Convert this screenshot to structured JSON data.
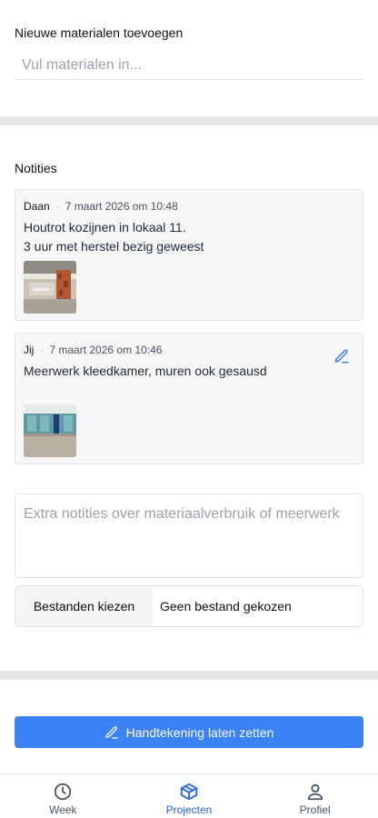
{
  "materials": {
    "title": "Nieuwe materialen toevoegen",
    "placeholder": "Vul materialen in..."
  },
  "notes": {
    "title": "Notities",
    "items": [
      {
        "author": "Daan",
        "separator": "·",
        "timestamp": "7 maart 2026 om 10:48",
        "text": "Houtrot kozijnen in lokaal 11.\n3 uur met herstel bezig geweest",
        "editable": false
      },
      {
        "author": "Jij",
        "separator": "·",
        "timestamp": "7 maart 2026 om 10:46",
        "text": "Meerwerk kleedkamer, muren ook gesausd",
        "editable": true
      }
    ],
    "extra_placeholder": "Extra notities over materiaalverbruik of meerwerk",
    "file_button": "Bestanden kiezen",
    "file_status": "Geen bestand gekozen"
  },
  "signature_button": "Handtekening laten zetten",
  "nav": {
    "items": [
      {
        "label": "Week",
        "icon": "clock-icon"
      },
      {
        "label": "Projecten",
        "icon": "box-icon",
        "active": true
      },
      {
        "label": "Profiel",
        "icon": "user-icon"
      }
    ]
  },
  "colors": {
    "accent": "#3b82f6",
    "nav_active": "#2563eb"
  }
}
